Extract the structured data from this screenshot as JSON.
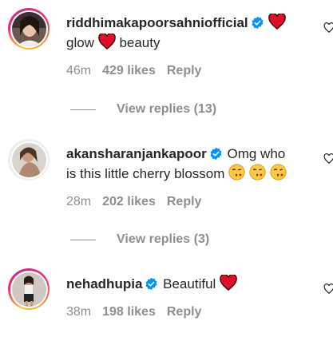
{
  "comments": [
    {
      "username": "riddhimakapoorsahniofficial",
      "text_before": "glow",
      "text_after": "beauty",
      "time": "46m",
      "likes": "429 likes",
      "reply": "Reply",
      "view_replies": "View replies (13)"
    },
    {
      "username": "akansharanjankapoor",
      "text_line1": "Omg who",
      "text_line2": "is this little cherry blossom",
      "time": "28m",
      "likes": "202 likes",
      "reply": "Reply",
      "view_replies": "View replies (3)"
    },
    {
      "username": "nehadhupia",
      "text": "Beautiful",
      "time": "38m",
      "likes": "198 likes",
      "reply": "Reply"
    }
  ],
  "icons": {
    "verified": "verified-badge-icon",
    "heart_emoji": "red-heart-emoji",
    "kiss_emoji": "face-blowing-kiss-emoji",
    "like": "heart-outline-icon"
  },
  "colors": {
    "verified_blue": "#0095f6",
    "heart_red": "#e0102b",
    "meta_gray": "#8e8e8e",
    "text": "#262626"
  }
}
